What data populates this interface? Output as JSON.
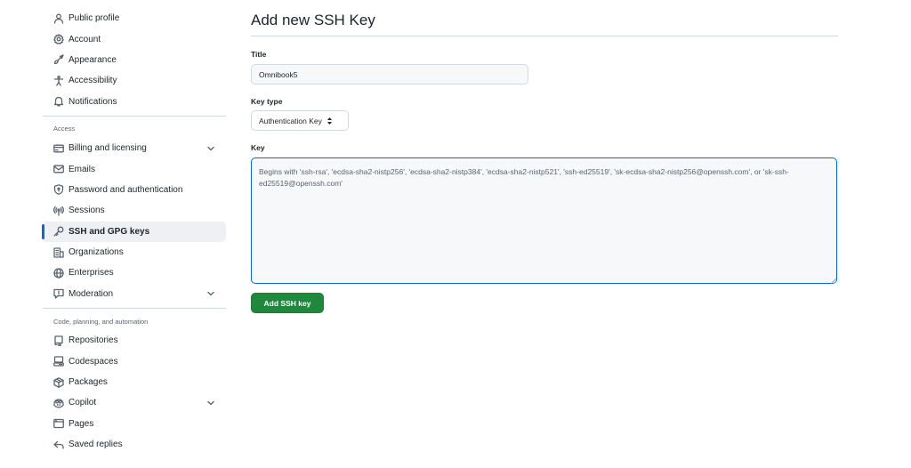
{
  "sidebar": {
    "top_items": [
      {
        "label": "Public profile",
        "icon": "person-icon"
      },
      {
        "label": "Account",
        "icon": "gear-icon"
      },
      {
        "label": "Appearance",
        "icon": "paintbrush-icon"
      },
      {
        "label": "Accessibility",
        "icon": "accessibility-icon"
      },
      {
        "label": "Notifications",
        "icon": "bell-icon"
      }
    ],
    "access_heading": "Access",
    "access_items": [
      {
        "label": "Billing and licensing",
        "icon": "credit-card-icon",
        "expandable": true
      },
      {
        "label": "Emails",
        "icon": "mail-icon"
      },
      {
        "label": "Password and authentication",
        "icon": "shield-lock-icon"
      },
      {
        "label": "Sessions",
        "icon": "broadcast-icon"
      },
      {
        "label": "SSH and GPG keys",
        "icon": "key-icon",
        "active": true
      },
      {
        "label": "Organizations",
        "icon": "organization-icon"
      },
      {
        "label": "Enterprises",
        "icon": "globe-icon"
      },
      {
        "label": "Moderation",
        "icon": "report-icon",
        "expandable": true
      }
    ],
    "code_heading": "Code, planning, and automation",
    "code_items": [
      {
        "label": "Repositories",
        "icon": "repo-icon"
      },
      {
        "label": "Codespaces",
        "icon": "codespaces-icon"
      },
      {
        "label": "Packages",
        "icon": "package-icon"
      },
      {
        "label": "Copilot",
        "icon": "copilot-icon",
        "expandable": true
      },
      {
        "label": "Pages",
        "icon": "browser-icon"
      },
      {
        "label": "Saved replies",
        "icon": "reply-icon"
      }
    ]
  },
  "main": {
    "title": "Add new SSH Key",
    "title_label": "Title",
    "title_value": "Omnibook5",
    "key_type_label": "Key type",
    "key_type_value": "Authentication Key",
    "key_label": "Key",
    "key_placeholder": "Begins with 'ssh-rsa', 'ecdsa-sha2-nistp256', 'ecdsa-sha2-nistp384', 'ecdsa-sha2-nistp521', 'ssh-ed25519', 'sk-ecdsa-sha2-nistp256@openssh.com', or 'sk-ssh-ed25519@openssh.com'",
    "submit_label": "Add SSH key"
  },
  "colors": {
    "accent": "#0969da",
    "primary_button": "#1f883d",
    "active_nav_bg": "#eef0f3"
  }
}
